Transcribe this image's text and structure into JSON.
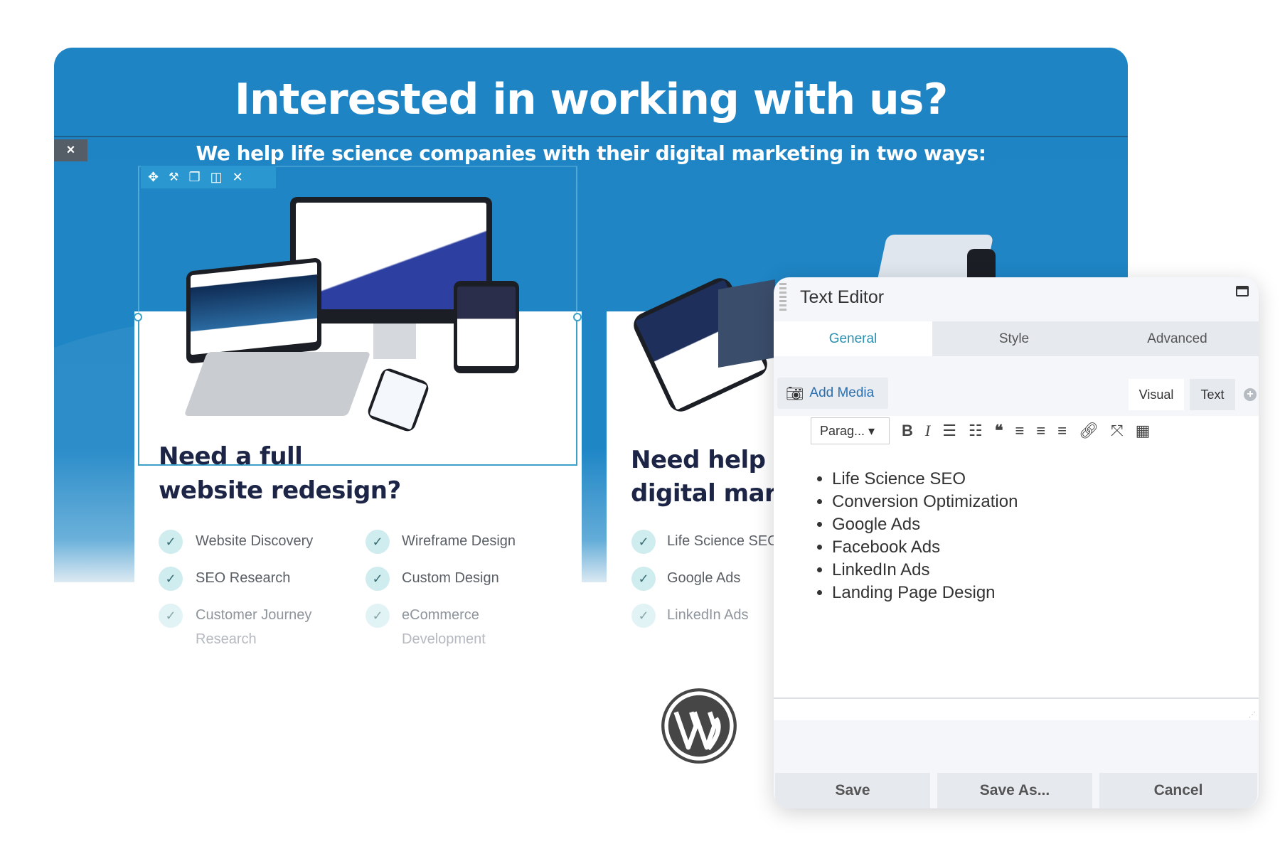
{
  "hero": {
    "title": "Interested in working with us?",
    "subtitle": "We help life science companies with their digital marketing in two ways:",
    "close_icon": "×"
  },
  "colors": {
    "hero_blue": "#1f84c4",
    "heading_navy": "#1d2547",
    "accent_teal": "#2a8fb0",
    "check_bg": "#cfecef"
  },
  "module_toolbar": {
    "icons": [
      "move-icon",
      "wrench-icon",
      "copy-icon",
      "columns-icon",
      "close-icon"
    ],
    "glyphs": [
      "✥",
      "🔧",
      "❐",
      "◫",
      "✕"
    ]
  },
  "card1": {
    "heading_line1": "Need a full",
    "heading_line2": "website redesign?",
    "col1": [
      "Website Discovery",
      "SEO Research",
      "Customer Journey",
      "Research"
    ],
    "col2": [
      "Wireframe Design",
      "Custom Design",
      "eCommerce",
      "Development"
    ]
  },
  "card2": {
    "heading_line1": "Need help w",
    "heading_line2": "digital mark",
    "items": [
      "Life Science SEO",
      "Google Ads",
      "LinkedIn Ads"
    ]
  },
  "editor": {
    "title": "Text Editor",
    "tabs": [
      {
        "label": "General",
        "active": true
      },
      {
        "label": "Style"
      },
      {
        "label": "Advanced"
      }
    ],
    "add_media": "Add Media",
    "mode_visual": "Visual",
    "mode_text": "Text",
    "format_select": "Parag...",
    "toolbar_icons": [
      "bold-icon",
      "italic-icon",
      "bullet-list-icon",
      "numbered-list-icon",
      "blockquote-icon",
      "align-left-icon",
      "align-center-icon",
      "align-right-icon",
      "link-icon",
      "fullscreen-icon",
      "toolbar-toggle-icon"
    ],
    "toolbar_glyphs": [
      "B",
      "I",
      "☰",
      "☷",
      "❝",
      "≡",
      "≡",
      "≡",
      "🔗",
      "⤧",
      "▦"
    ],
    "content": [
      "Life Science SEO",
      "Conversion Optimization",
      "Google Ads",
      "Facebook Ads",
      "LinkedIn Ads",
      "Landing Page Design"
    ],
    "buttons": {
      "save": "Save",
      "save_as": "Save As...",
      "cancel": "Cancel"
    }
  }
}
